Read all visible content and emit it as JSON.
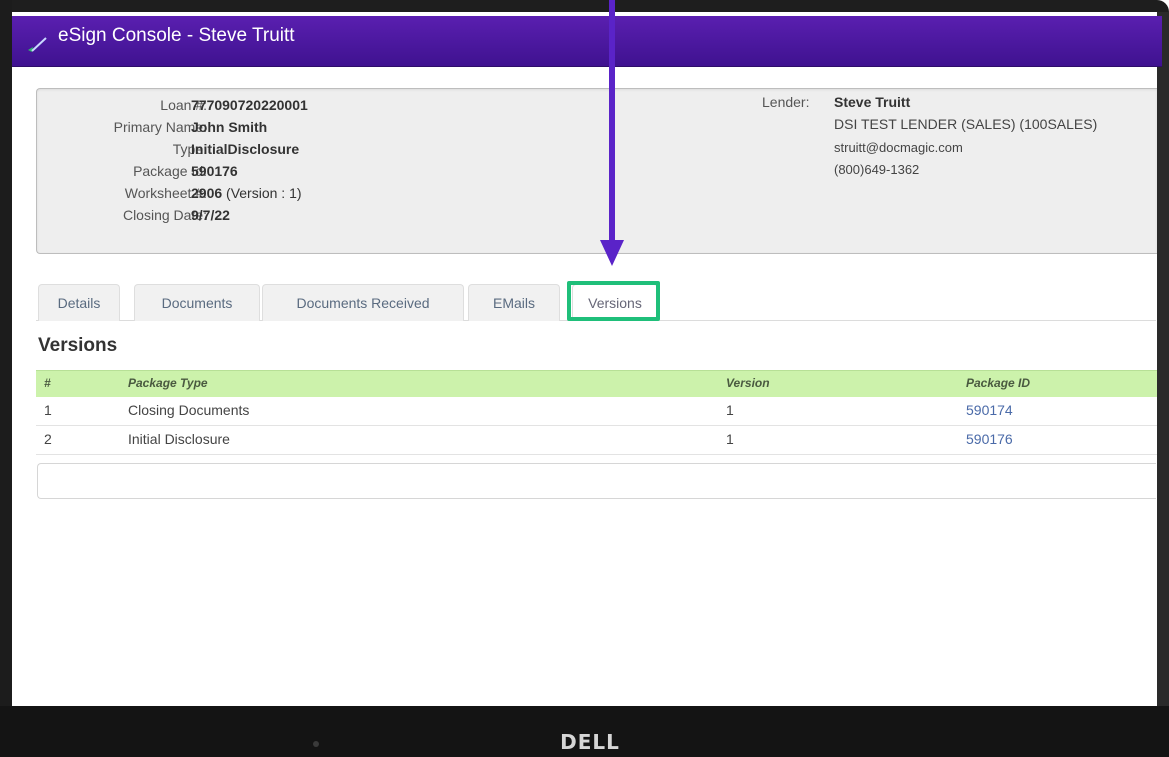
{
  "app": {
    "title": "eSign Console - Steve Truitt",
    "logo_icon": "checkmark-logo-icon",
    "accent_color": "#4a169e"
  },
  "loan_info": {
    "fields": [
      {
        "label": "Loan #:",
        "value": "777090720220001"
      },
      {
        "label": "Primary Name:",
        "value": "John Smith"
      },
      {
        "label": "Type:",
        "value": "InitialDisclosure"
      },
      {
        "label": "Package Id:",
        "value": "590176"
      },
      {
        "label": "Worksheet #:",
        "value": "2906",
        "suffix": "(Version : 1)"
      },
      {
        "label": "Closing Date:",
        "value": "9/7/22"
      }
    ],
    "lender": {
      "label": "Lender:",
      "name": "Steve Truitt",
      "company": "DSI TEST LENDER (SALES) (100SALES)",
      "email": "struitt@docmagic.com",
      "phone": "(800)649-1362"
    }
  },
  "tabs": [
    {
      "label": "Details"
    },
    {
      "label": "Documents"
    },
    {
      "label": "Documents Received"
    },
    {
      "label": "EMails"
    },
    {
      "label": "Versions",
      "active": true
    }
  ],
  "highlight_color": "#1fbf7a",
  "arrow_color": "#5a23c8",
  "versions": {
    "title": "Versions",
    "header_color": "#ccf2ab",
    "columns": [
      "#",
      "Package Type",
      "Version",
      "Package ID"
    ],
    "rows": [
      {
        "num": "1",
        "type": "Closing Documents",
        "version": "1",
        "package_id": "590174"
      },
      {
        "num": "2",
        "type": "Initial Disclosure",
        "version": "1",
        "package_id": "590176"
      }
    ]
  },
  "device": {
    "brand": "DELL"
  }
}
